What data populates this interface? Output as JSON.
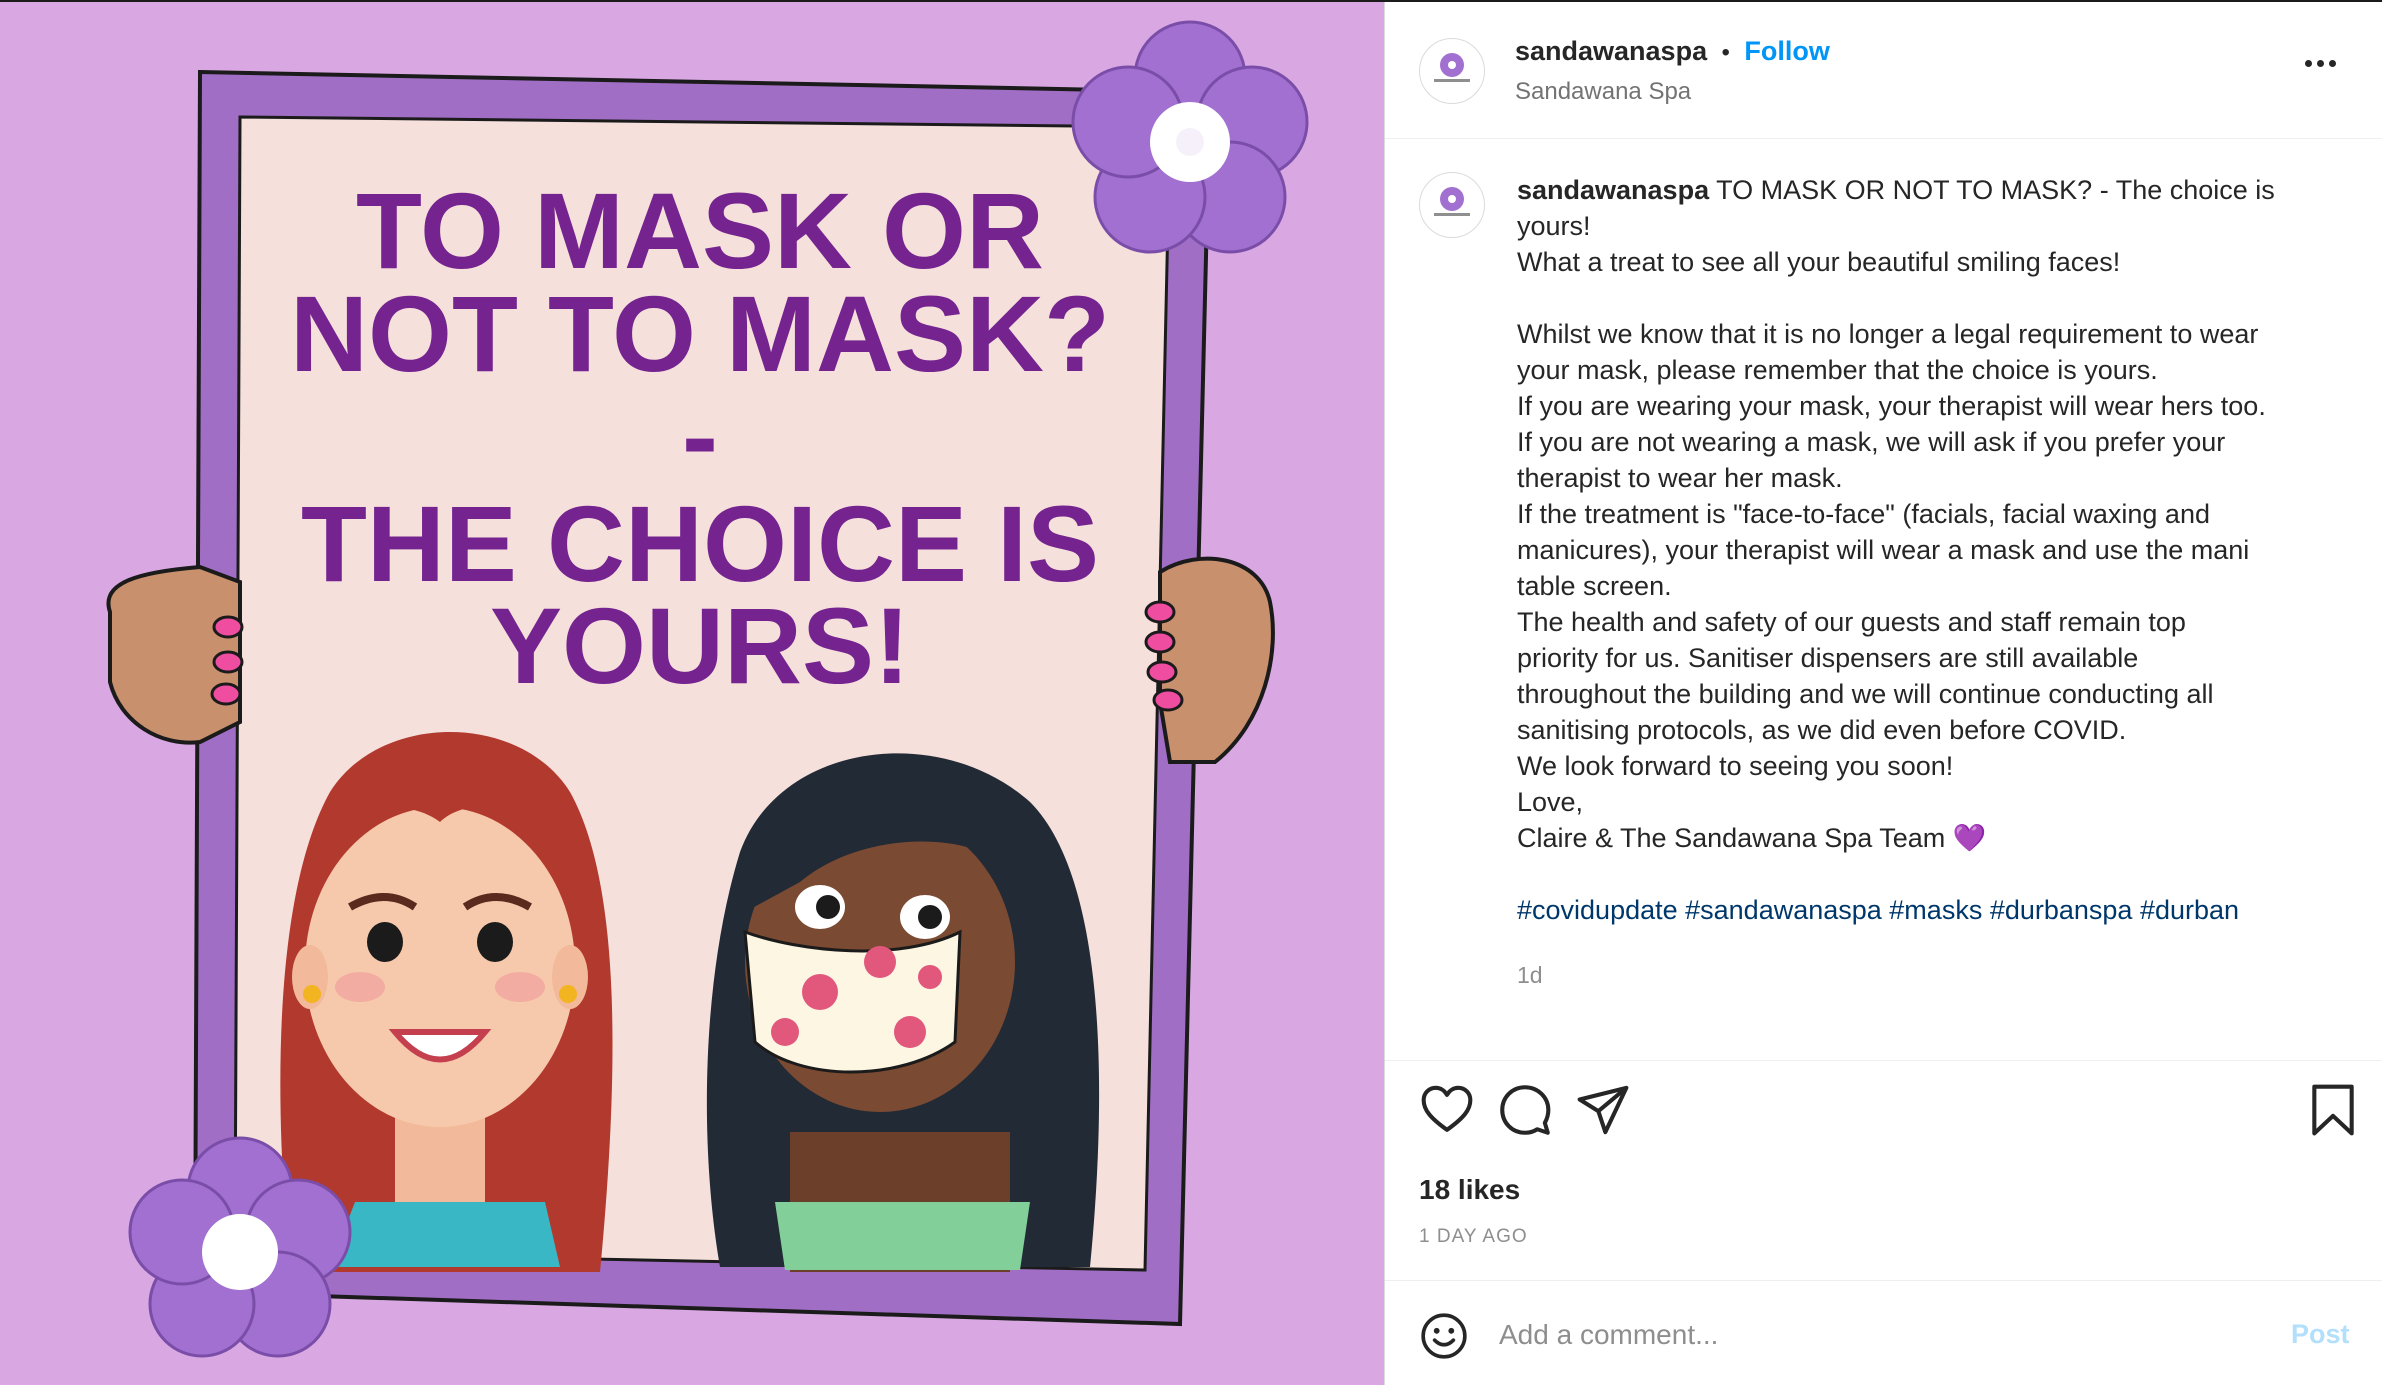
{
  "image": {
    "sign_lines": [
      "TO MASK OR",
      "NOT TO MASK?",
      "-",
      "THE CHOICE IS",
      "YOURS!"
    ]
  },
  "header": {
    "username": "sandawanaspa",
    "separator": "•",
    "follow_label": "Follow",
    "subtitle": "Sandawana Spa"
  },
  "caption": {
    "username": "sandawanaspa",
    "lines": [
      "TO MASK OR NOT TO MASK? - The choice is",
      "yours!",
      "What a treat to see all your beautiful smiling faces!",
      "",
      "Whilst we know that it is no longer a legal requirement to wear",
      "your mask, please remember that the choice is yours.",
      "If you are wearing your mask, your therapist will wear hers too.",
      "If you are not wearing a mask, we will ask if you prefer your",
      "therapist to wear her mask.",
      "If the treatment is \"face-to-face\" (facials, facial waxing and",
      "manicures), your therapist will wear a mask and use the mani",
      "table screen.",
      "The health and safety of our guests and staff remain top",
      "priority for us. Sanitiser dispensers are still available",
      "throughout the building and we will continue conducting all",
      "sanitising protocols, as we did even before COVID.",
      "We look forward to seeing you soon!",
      "Love,",
      "Claire & The Sandawana Spa Team 💜"
    ],
    "hashtags": "#covidupdate #sandawanaspa #masks #durbanspa #durban",
    "time": "1d"
  },
  "actions": {
    "like_icon": "heart-icon",
    "comment_icon": "comment-icon",
    "share_icon": "paper-plane-icon",
    "save_icon": "bookmark-icon"
  },
  "likes": "18 likes",
  "posted_ago": "1 DAY AGO",
  "comment": {
    "placeholder": "Add a comment...",
    "post_label": "Post",
    "emoji_icon": "smiley-icon"
  },
  "colors": {
    "background_purple": "#d9a8e3",
    "sign_text": "#74238f",
    "follow": "#0095f6",
    "hashtag": "#00376b",
    "post_disabled": "#b2dffc"
  }
}
